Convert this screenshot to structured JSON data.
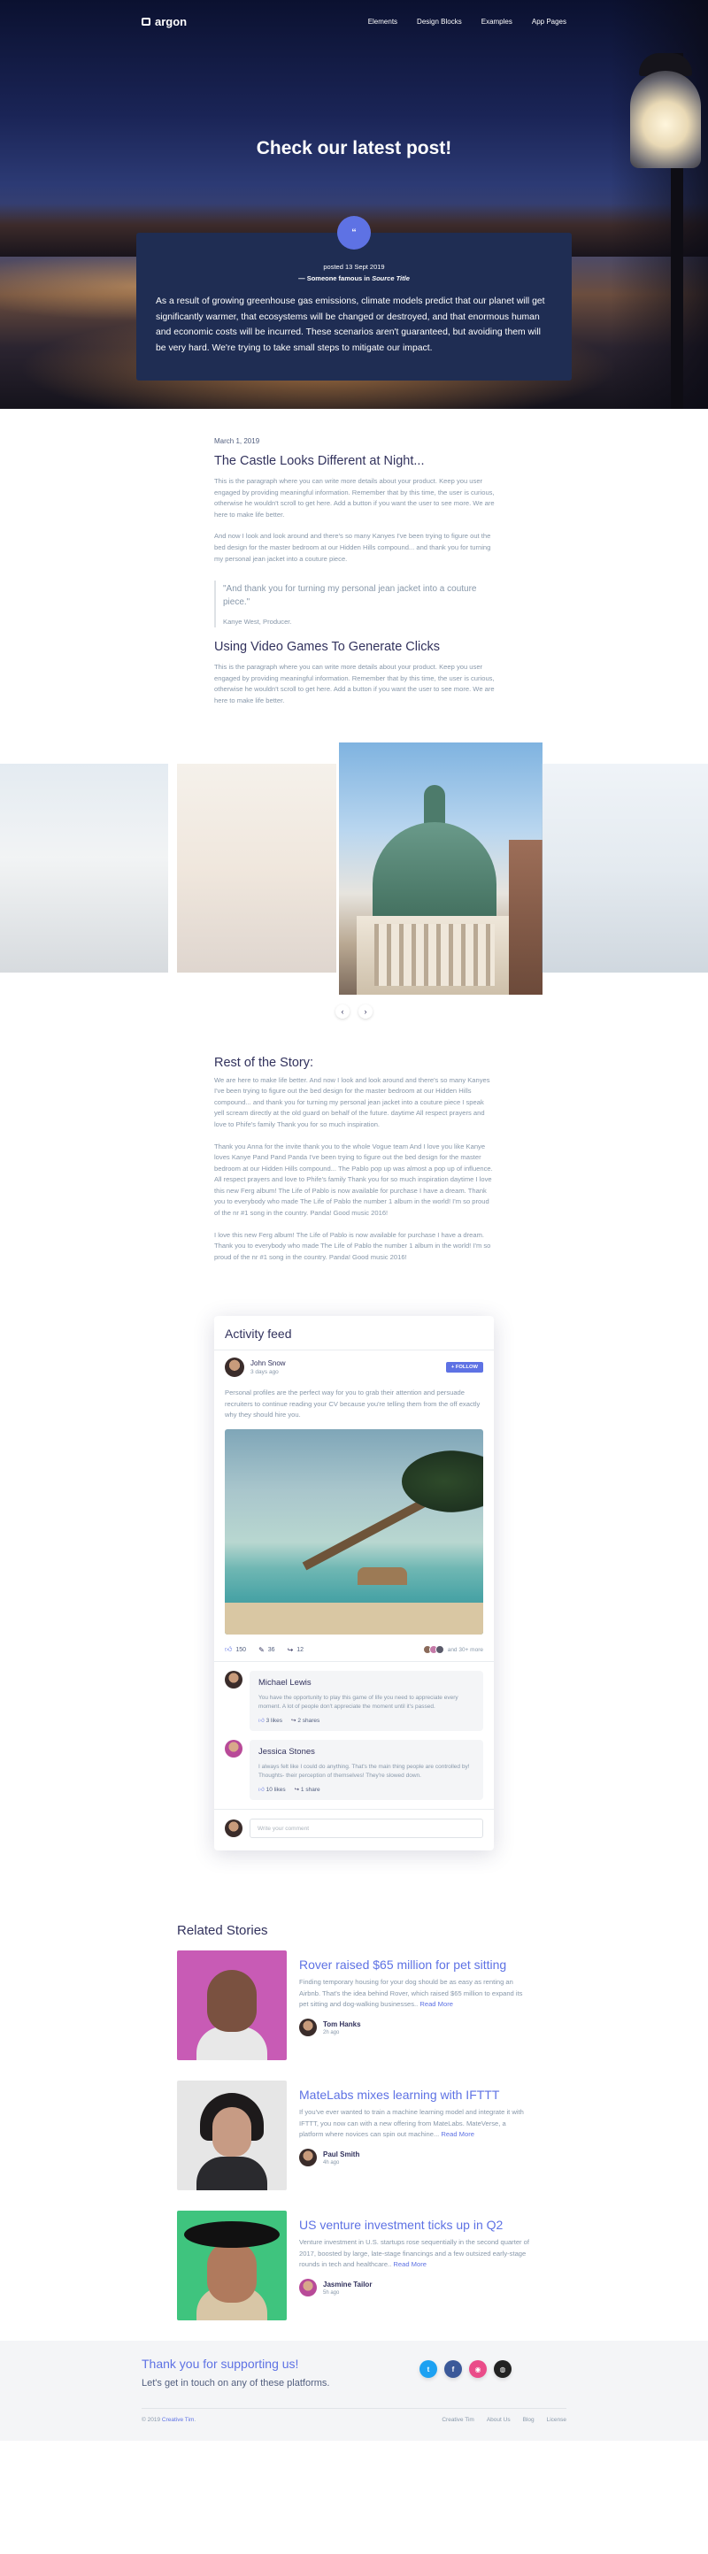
{
  "nav": {
    "brand": "argon",
    "links": [
      "Elements",
      "Design Blocks",
      "Examples",
      "App Pages"
    ]
  },
  "hero": {
    "title": "Check our latest post!",
    "badge": "“",
    "posted": "posted 13 Sept 2019",
    "source_prefix": "— Someone famous in",
    "source_title": "Source Title",
    "quote": "As a result of growing greenhouse gas emissions, climate models predict that our planet will get significantly warmer, that ecosystems will be changed or destroyed, and that enormous human and economic costs will be incurred. These scenarios aren't guaranteed, but avoiding them will be very hard. We're trying to take small steps to mitigate our impact."
  },
  "article": {
    "date": "March 1, 2019",
    "title": "The Castle Looks Different at Night...",
    "p1": "This is the paragraph where you can write more details about your product. Keep you user engaged by providing meaningful information. Remember that by this time, the user is curious, otherwise he wouldn't scroll to get here. Add a button if you want the user to see more. We are here to make life better.",
    "p2": "And now I look and look around and there's so many Kanyes I've been trying to figure out the bed design for the master bedroom at our Hidden Hills compound... and thank you for turning my personal jean jacket into a couture piece.",
    "quote": "\"And thank you for turning my personal jean jacket into a couture piece.\"",
    "quote_author": "Kanye West, Producer.",
    "title2": "Using Video Games To Generate Clicks",
    "p3": "This is the paragraph where you can write more details about your product. Keep you user engaged by providing meaningful information. Remember that by this time, the user is curious, otherwise he wouldn't scroll to get here. Add a button if you want the user to see more. We are here to make life better."
  },
  "gallery": {
    "prev_icon": "chevron-left-icon",
    "next_icon": "chevron-right-icon",
    "prev": "‹",
    "next": "›"
  },
  "story": {
    "title": "Rest of the Story:",
    "p1": "We are here to make life better. And now I look and look around and there's so many Kanyes I've been trying to figure out the bed design for the master bedroom at our Hidden Hills compound... and thank you for turning my personal jean jacket into a couture piece I speak yell scream directly at the old guard on behalf of the future. daytime All respect prayers and love to Phife's family Thank you for so much inspiration.",
    "p2": "Thank you Anna for the invite thank you to the whole Vogue team And I love you like Kanye loves Kanye Pand Pand Panda I've been trying to figure out the bed design for the master bedroom at our Hidden Hills compound... The Pablo pop up was almost a pop up of influence. All respect prayers and love to Phife's family Thank you for so much inspiration daytime I love this new Ferg album! The Life of Pablo is now available for purchase I have a dream. Thank you to everybody who made The Life of Pablo the number 1 album in the world! I'm so proud of the nr #1 song in the country. Panda! Good music 2016!",
    "p3": "I love this new Ferg album! The Life of Pablo is now available for purchase I have a dream. Thank you to everybody who made The Life of Pablo the number 1 album in the world! I'm so proud of the nr #1 song in the country. Panda! Good music 2016!"
  },
  "feed": {
    "title": "Activity feed",
    "user_name": "John Snow",
    "user_time": "3 days ago",
    "follow": "+ FOLLOW",
    "text": "Personal profiles are the perfect way for you to grab their attention and persuade recruiters to continue reading your CV because you're telling them from the off exactly why they should hire you.",
    "likes": "150",
    "comments": "36",
    "shares": "12",
    "liked_by": "and 30+ more",
    "comment1": {
      "name": "Michael Lewis",
      "text": "You have the opportunity to play this game of life you need to appreciate every moment. A lot of people don't appreciate the moment until it's passed.",
      "likes": "3 likes",
      "shares": "2 shares"
    },
    "comment2": {
      "name": "Jessica Stones",
      "text": "I always felt like I could do anything. That's the main thing people are controlled by! Thoughts- their perception of themselves! They're slowed down.",
      "likes": "10 likes",
      "shares": "1 share"
    },
    "placeholder": "Write your comment"
  },
  "related": {
    "title": "Related Stories",
    "items": [
      {
        "title": "Rover raised $65 million for pet sitting",
        "text": "Finding temporary housing for your dog should be as easy as renting an Airbnb. That's the idea behind Rover, which raised $65 million to expand its pet sitting and dog-walking businesses..",
        "more": "Read More",
        "author": "Tom Hanks",
        "time": "2h ago"
      },
      {
        "title": "MateLabs mixes learning with IFTTT",
        "text": "If you've ever wanted to train a machine learning model and integrate it with IFTTT, you now can with a new offering from MateLabs. MateVerse, a platform where novices can spin out machine...",
        "more": "Read More",
        "author": "Paul Smith",
        "time": "4h ago"
      },
      {
        "title": "US venture investment ticks up in Q2",
        "text": "Venture investment in U.S. startups rose sequentially in the second quarter of 2017, boosted by large, late-stage financings and a few outsized early-stage rounds in tech and healthcare..",
        "more": "Read More",
        "author": "Jasmine Tailor",
        "time": "5h ago"
      }
    ]
  },
  "footer": {
    "title": "Thank you for supporting us!",
    "subtitle": "Let's get in touch on any of these platforms.",
    "socials": [
      {
        "icon": "twitter-icon",
        "glyph": "t",
        "color": "#1da1f2"
      },
      {
        "icon": "facebook-icon",
        "glyph": "f",
        "color": "#3b5999"
      },
      {
        "icon": "dribbble-icon",
        "glyph": "◉",
        "color": "#ea4c89"
      },
      {
        "icon": "github-icon",
        "glyph": "◍",
        "color": "#222222"
      }
    ],
    "copyright_prefix": "© 2019",
    "copyright_link": "Creative Tim",
    "links": [
      "Creative Tim",
      "About Us",
      "Blog",
      "License"
    ]
  },
  "colors": {
    "primary": "#5e72e4",
    "heading": "#32325d",
    "muted": "#8898aa",
    "quote_card": "#1f2d53"
  }
}
